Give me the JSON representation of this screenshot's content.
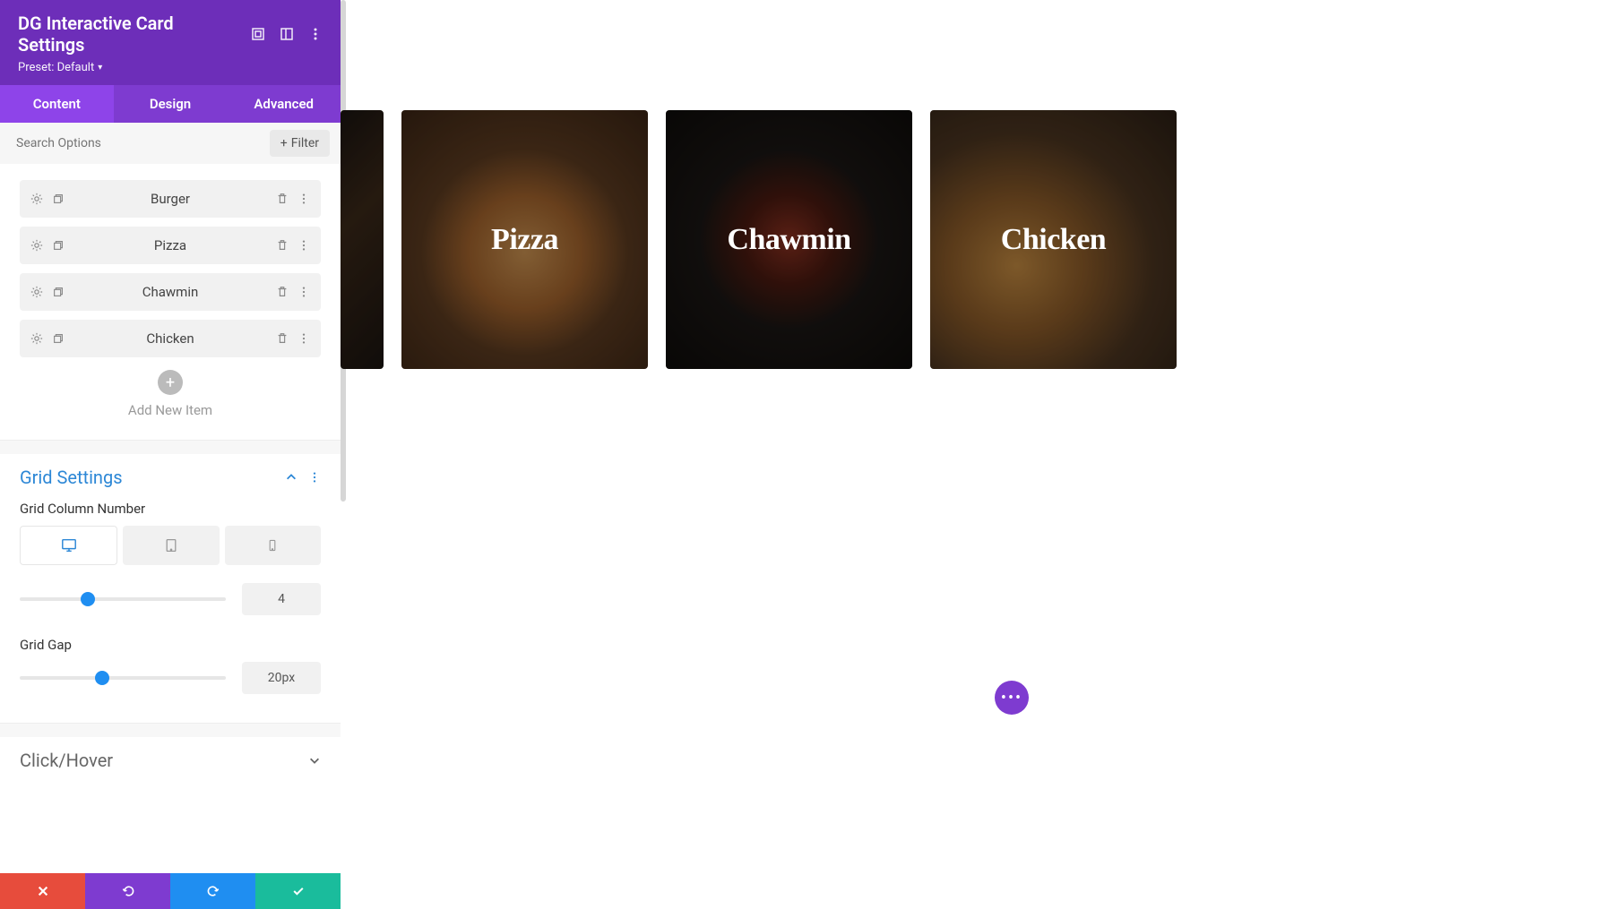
{
  "header": {
    "title": "DG Interactive Card Settings",
    "preset_label": "Preset: Default"
  },
  "tabs": {
    "content": "Content",
    "design": "Design",
    "advanced": "Advanced"
  },
  "search": {
    "placeholder": "Search Options",
    "filter_label": "Filter"
  },
  "items": [
    {
      "label": "Burger"
    },
    {
      "label": "Pizza"
    },
    {
      "label": "Chawmin"
    },
    {
      "label": "Chicken"
    }
  ],
  "add_new_label": "Add New Item",
  "grid_settings": {
    "title": "Grid Settings",
    "column_label": "Grid Column Number",
    "column_value": "4",
    "gap_label": "Grid Gap",
    "gap_value": "20px"
  },
  "click_hover": {
    "title": "Click/Hover"
  },
  "cards": [
    {
      "title": "Pizza"
    },
    {
      "title": "Chawmin"
    },
    {
      "title": "Chicken"
    }
  ]
}
